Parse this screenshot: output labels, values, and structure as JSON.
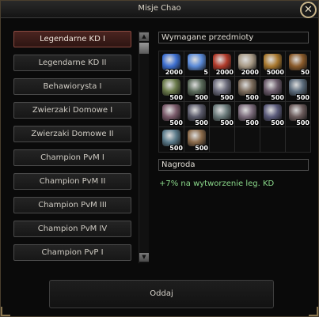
{
  "window": {
    "title": "Misje Chao",
    "close_label": "✕"
  },
  "quests": [
    {
      "label": "Legendarne KD I",
      "active": true
    },
    {
      "label": "Legendarne KD II",
      "active": false
    },
    {
      "label": "Behawiorysta I",
      "active": false
    },
    {
      "label": "Zwierzaki Domowe I",
      "active": false
    },
    {
      "label": "Zwierzaki Domowe II",
      "active": false
    },
    {
      "label": "Champion PvM I",
      "active": false
    },
    {
      "label": "Champion PvM II",
      "active": false
    },
    {
      "label": "Champion PvM III",
      "active": false
    },
    {
      "label": "Champion PvM IV",
      "active": false
    },
    {
      "label": "Champion PvP I",
      "active": false
    }
  ],
  "scrollbar": {
    "up_label": "▲",
    "down_label": "▼"
  },
  "required": {
    "title": "Wymagane przedmioty",
    "items": [
      {
        "qty": "2000",
        "icon": "blue-gem-cluster-icon",
        "color": "#3d6fd0"
      },
      {
        "qty": "5",
        "icon": "blue-crystal-icon",
        "color": "#5a8ad8"
      },
      {
        "qty": "2000",
        "icon": "red-scroll-icon",
        "color": "#b03a2a"
      },
      {
        "qty": "2000",
        "icon": "bone-icon",
        "color": "#a89a86"
      },
      {
        "qty": "5000",
        "icon": "bronze-amulet-icon",
        "color": "#a8782e"
      },
      {
        "qty": "50",
        "icon": "brown-shell-icon",
        "color": "#8a5a2a"
      },
      {
        "qty": "500",
        "icon": "fish-icon",
        "color": "#6a7a4a"
      },
      {
        "qty": "500",
        "icon": "fish-icon",
        "color": "#5a6a5a"
      },
      {
        "qty": "500",
        "icon": "fish-icon",
        "color": "#6a6a7a"
      },
      {
        "qty": "500",
        "icon": "fish-icon",
        "color": "#7a6a5a"
      },
      {
        "qty": "500",
        "icon": "fish-icon",
        "color": "#6a5a6a"
      },
      {
        "qty": "500",
        "icon": "fish-icon",
        "color": "#5a6a7a"
      },
      {
        "qty": "500",
        "icon": "fish-icon",
        "color": "#7a5a6a"
      },
      {
        "qty": "500",
        "icon": "fish-icon",
        "color": "#5a5a6a"
      },
      {
        "qty": "500",
        "icon": "fish-icon",
        "color": "#6a7a7a"
      },
      {
        "qty": "500",
        "icon": "fish-icon",
        "color": "#7a6a7a"
      },
      {
        "qty": "500",
        "icon": "fish-icon",
        "color": "#5a5a7a"
      },
      {
        "qty": "500",
        "icon": "fish-icon",
        "color": "#6a5a5a"
      },
      {
        "qty": "500",
        "icon": "fish-icon",
        "color": "#5a7a8a"
      },
      {
        "qty": "500",
        "icon": "fish-icon",
        "color": "#8a6a4a"
      },
      {
        "qty": "",
        "icon": "empty-slot",
        "color": ""
      },
      {
        "qty": "",
        "icon": "empty-slot",
        "color": ""
      },
      {
        "qty": "",
        "icon": "empty-slot",
        "color": ""
      },
      {
        "qty": "",
        "icon": "empty-slot",
        "color": ""
      }
    ]
  },
  "reward": {
    "title": "Nagroda",
    "text": "+7% na wytworzenie leg. KD",
    "color": "#8ad88a"
  },
  "submit": {
    "label": "Oddaj"
  }
}
